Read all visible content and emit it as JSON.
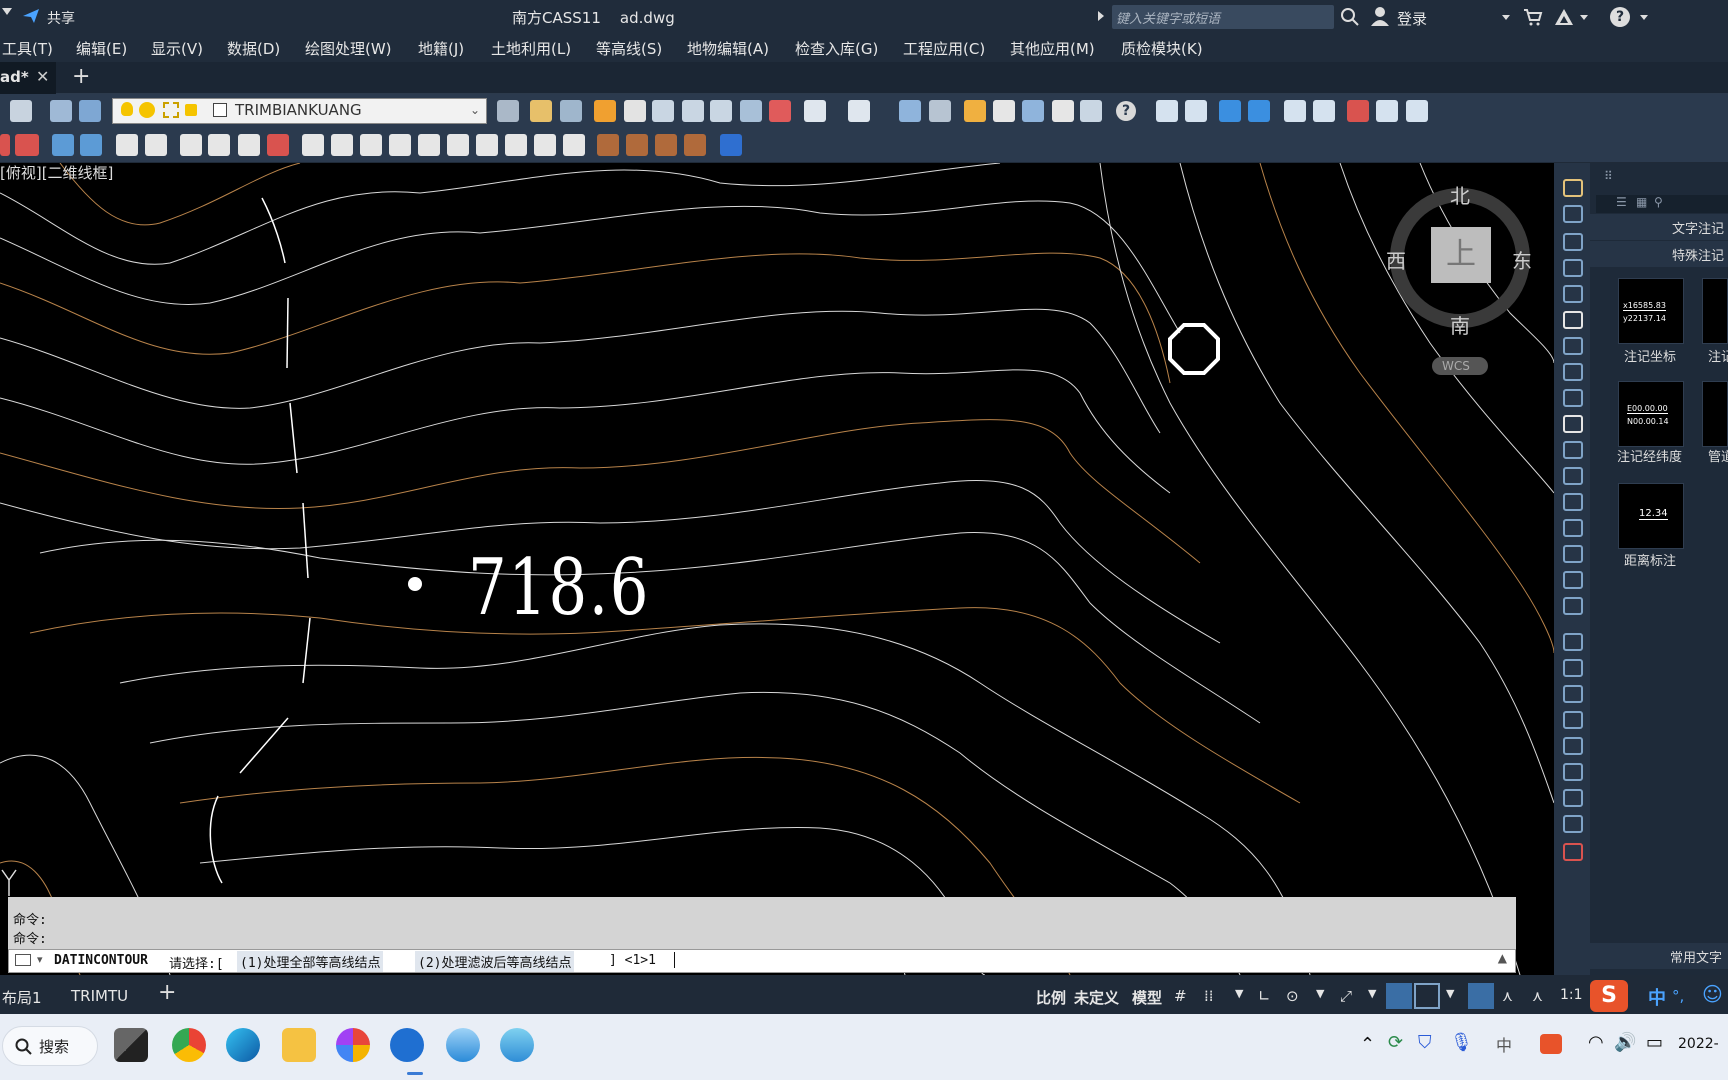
{
  "titlebar": {
    "share_label": "共享",
    "window_title": "南方CASS11    ad.dwg",
    "search_placeholder": "键入关键字或短语",
    "login_label": "登录"
  },
  "menu": [
    "工具(T)",
    "编辑(E)",
    "显示(V)",
    "数据(D)",
    "绘图处理(W)",
    "地籍(J)",
    "土地利用(L)",
    "等高线(S)",
    "地物编辑(A)",
    "检查入库(G)",
    "工程应用(C)",
    "其他应用(M)",
    "质检模块(K)"
  ],
  "tabs": {
    "document": "ad*"
  },
  "layer": {
    "current": "TRIMBIANKUANG"
  },
  "viewport": {
    "label": "[俯视][二维线框]",
    "elevation_text": "718.6"
  },
  "viewcube": {
    "north": "北",
    "south": "南",
    "east": "东",
    "west": "西",
    "face": "上",
    "wcs": "WCS"
  },
  "right_panel": {
    "header1": "文字注记",
    "header2": "特殊注记",
    "items": [
      {
        "label": "注记坐标",
        "thumb_line1": "x16585.83",
        "thumb_line2": "y22137.14"
      },
      {
        "label": "注记经纬度",
        "thumb_line1": "E00.00.00",
        "thumb_line2": "N00.00.14"
      },
      {
        "label": "距离标注",
        "thumb_line1": "12.34",
        "thumb_line2": ""
      }
    ],
    "partial_label1": "注记",
    "partial_label2": "管道",
    "footer": "常用文字"
  },
  "command": {
    "history": [
      "命令:",
      "命令:"
    ],
    "cmd_name": "DATINCONTOUR",
    "prompt_prefix": "请选择:[",
    "option1": "(1)处理全部等高线结点",
    "option2": "(2)处理滤波后等高线结点",
    "prompt_suffix": "] <1>1"
  },
  "statusbar": {
    "layout1": "布局1",
    "layout2": "TRIMTU",
    "scale_label": "比例",
    "scale_value": "未定义",
    "model": "模型",
    "ratio": "1:1"
  },
  "taskbar": {
    "search_label": "搜索",
    "ime1": "中",
    "ime2": "中",
    "date_partial": "2022-"
  },
  "colors": {
    "contour_major": "#b8834a",
    "contour_minor": "#d9d9d9",
    "background": "#000000",
    "accent": "#4aa3ff"
  }
}
